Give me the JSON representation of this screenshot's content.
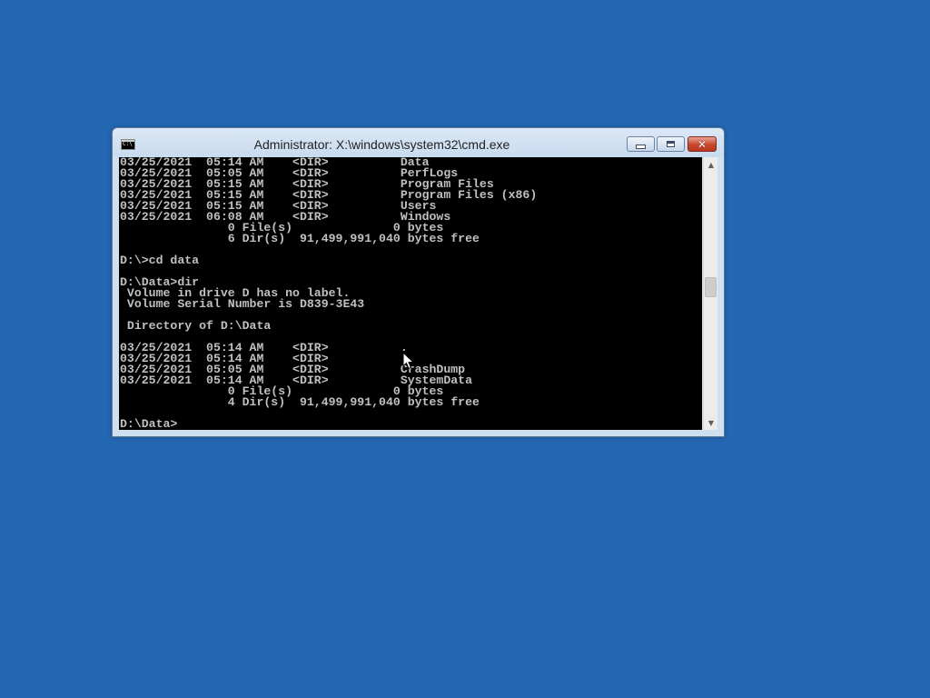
{
  "window": {
    "title": "Administrator: X:\\windows\\system32\\cmd.exe",
    "icon_label": "C:\\",
    "controls": {
      "minimize": "minimize-icon",
      "maximize": "maximize-icon",
      "close": "close-icon"
    }
  },
  "console": {
    "lines": [
      "03/25/2021  05:14 AM    <DIR>          Data",
      "03/25/2021  05:05 AM    <DIR>          PerfLogs",
      "03/25/2021  05:15 AM    <DIR>          Program Files",
      "03/25/2021  05:15 AM    <DIR>          Program Files (x86)",
      "03/25/2021  05:15 AM    <DIR>          Users",
      "03/25/2021  06:08 AM    <DIR>          Windows",
      "               0 File(s)              0 bytes",
      "               6 Dir(s)  91,499,991,040 bytes free",
      "",
      "D:\\>cd data",
      "",
      "D:\\Data>dir",
      " Volume in drive D has no label.",
      " Volume Serial Number is D839-3E43",
      "",
      " Directory of D:\\Data",
      "",
      "03/25/2021  05:14 AM    <DIR>          .",
      "03/25/2021  05:14 AM    <DIR>          ..",
      "03/25/2021  05:05 AM    <DIR>          CrashDump",
      "03/25/2021  05:14 AM    <DIR>          SystemData",
      "               0 File(s)              0 bytes",
      "               4 Dir(s)  91,499,991,040 bytes free",
      "",
      "D:\\Data>"
    ],
    "text_color": "#c0c0c0",
    "background_color": "#000000"
  },
  "scrollbar": {
    "up_arrow": "scroll-up-arrow-icon",
    "down_arrow": "scroll-down-arrow-icon"
  },
  "desktop": {
    "background_color": "#2467b3"
  }
}
